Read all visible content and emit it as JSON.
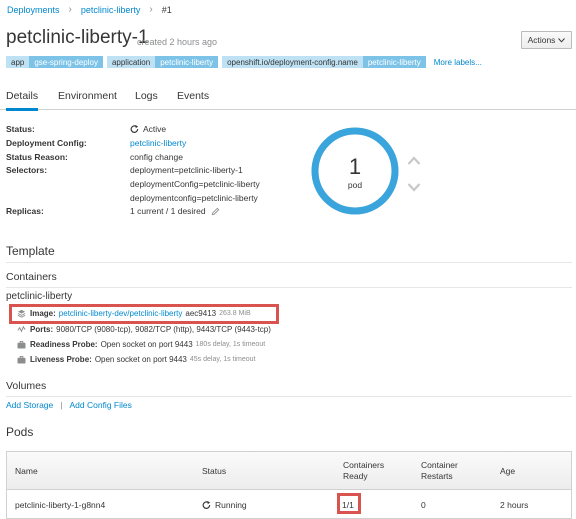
{
  "breadcrumb": {
    "root": "Deployments",
    "config": "petclinic-liberty",
    "current": "#1"
  },
  "header": {
    "title": "petclinic-liberty-1",
    "created": "created 2 hours ago",
    "actions_label": "Actions"
  },
  "labels": [
    {
      "key": "app",
      "value": "gse-spring-deploy"
    },
    {
      "key": "application",
      "value": "petclinic-liberty"
    },
    {
      "key": "openshift.io/deployment-config.name",
      "value": "petclinic-liberty"
    }
  ],
  "more_labels": "More labels...",
  "tabs": [
    "Details",
    "Environment",
    "Logs",
    "Events"
  ],
  "details": {
    "status_label": "Status:",
    "status_value": "Active",
    "config_label": "Deployment Config:",
    "config_value": "petclinic-liberty",
    "reason_label": "Status Reason:",
    "reason_value": "config change",
    "selectors_label": "Selectors:",
    "selectors": [
      "deployment=petclinic-liberty-1",
      "deploymentConfig=petclinic-liberty",
      "deploymentconfig=petclinic-liberty"
    ],
    "replicas_label": "Replicas:",
    "replicas_value": "1 current / 1 desired"
  },
  "donut": {
    "count": "1",
    "unit": "pod",
    "ready_fraction": 1.0,
    "color": "#39a5dc"
  },
  "template": {
    "heading": "Template",
    "containers_heading": "Containers",
    "container_name": "petclinic-liberty",
    "image_label": "Image:",
    "image_link": "petclinic-liberty-dev/petclinic-liberty",
    "image_id": "aec9413",
    "image_size": "263.8 MiB",
    "ports_label": "Ports:",
    "ports_value": "9080/TCP (9080-tcp), 9082/TCP (http), 9443/TCP (9443-tcp)",
    "readiness_label": "Readiness Probe:",
    "readiness_value": "Open socket on port 9443",
    "readiness_meta": "180s delay, 1s timeout",
    "liveness_label": "Liveness Probe:",
    "liveness_value": "Open socket on port 9443",
    "liveness_meta": "45s delay, 1s timeout"
  },
  "volumes": {
    "heading": "Volumes",
    "add_storage": "Add Storage",
    "add_config": "Add Config Files"
  },
  "pods": {
    "heading": "Pods",
    "columns": {
      "name": "Name",
      "status": "Status",
      "ready_1": "Containers",
      "ready_2": "Ready",
      "restarts_1": "Container",
      "restarts_2": "Restarts",
      "age": "Age"
    },
    "rows": [
      {
        "name": "petclinic-liberty-1-g8nn4",
        "status": "Running",
        "ready": "1/1",
        "restarts": "0",
        "age": "2 hours"
      }
    ]
  },
  "colors": {
    "link": "#0088ce",
    "highlight": "#d9534f",
    "label_key": "#bee1f4",
    "label_value": "#7dc3e8"
  }
}
